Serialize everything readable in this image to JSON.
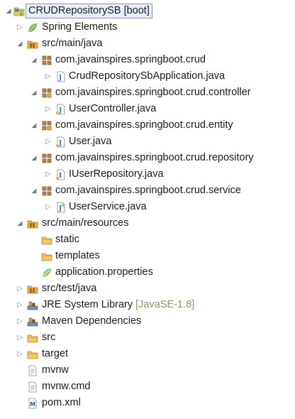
{
  "project": {
    "name": "CRUDRepositorySB",
    "decoration": "[boot]"
  },
  "items": [
    {
      "label": "Spring Elements"
    },
    {
      "label": "src/main/java"
    },
    {
      "label": "com.javainspires.springboot.crud"
    },
    {
      "label": "CrudRepositorySbApplication.java"
    },
    {
      "label": "com.javainspires.springboot.crud.controller"
    },
    {
      "label": "UserController.java"
    },
    {
      "label": "com.javainspires.springboot.crud.entity"
    },
    {
      "label": "User.java"
    },
    {
      "label": "com.javainspires.springboot.crud.repository"
    },
    {
      "label": "IUserRepository.java"
    },
    {
      "label": "com.javainspires.springboot.crud.service"
    },
    {
      "label": "UserService.java"
    },
    {
      "label": "src/main/resources"
    },
    {
      "label": "static"
    },
    {
      "label": "templates"
    },
    {
      "label": "application.properties"
    },
    {
      "label": "src/test/java"
    },
    {
      "label": "JRE System Library",
      "decoration": "[JavaSE-1.8]"
    },
    {
      "label": "Maven Dependencies"
    },
    {
      "label": "src"
    },
    {
      "label": "target"
    },
    {
      "label": "mvnw"
    },
    {
      "label": "mvnw.cmd"
    },
    {
      "label": "pom.xml"
    }
  ],
  "icons": {
    "project": "maven-spring-project-icon",
    "spring": "spring-leaf-icon",
    "source_folder": "source-folder-icon",
    "package": "package-icon",
    "java_file": "java-file-icon",
    "interface_file": "java-interface-file-icon",
    "folder": "folder-icon",
    "library": "library-icon",
    "file": "text-file-icon",
    "xml": "maven-xml-icon"
  },
  "colors": {
    "selection_bg": "#e5f0fb",
    "selection_border": "#6d9dd6",
    "decoration_text": "#9a8f56",
    "folder": "#e8b54a",
    "package": "#a0662c",
    "spring_green": "#6db33f"
  }
}
